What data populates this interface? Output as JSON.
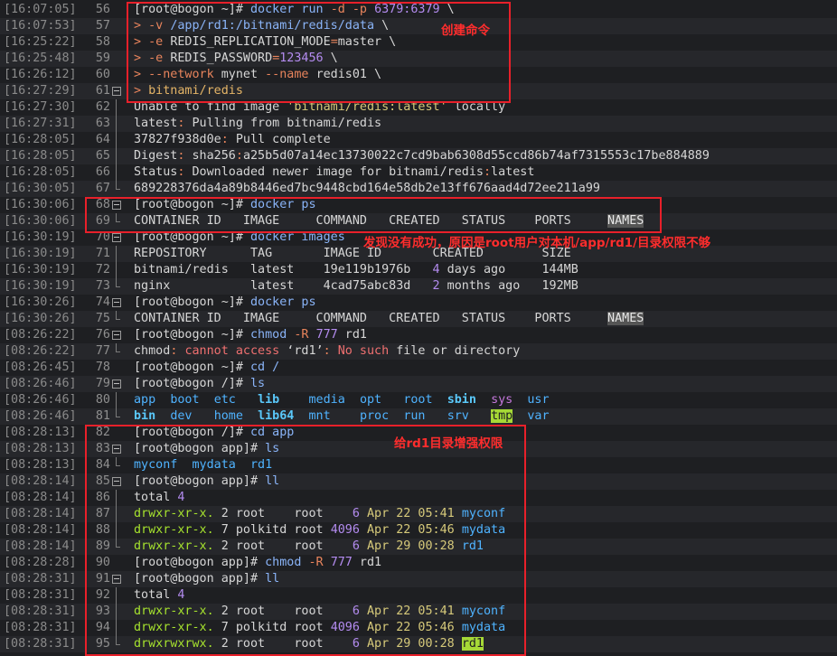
{
  "terminal": {
    "lines": [
      {
        "ts": "[16:07:05]",
        "ln": "56",
        "fold": "none",
        "segs": [
          [
            "[root@bogon ~]# ",
            "t-prompt"
          ],
          [
            "docker run ",
            "t-cmd"
          ],
          [
            "-d -p ",
            "t-opt"
          ],
          [
            "6379:6379",
            "t-num"
          ],
          [
            " \\",
            "t-def"
          ]
        ]
      },
      {
        "ts": "[16:07:53]",
        "ln": "57",
        "fold": "none",
        "segs": [
          [
            "> ",
            "t-opt"
          ],
          [
            "-v ",
            "t-opt"
          ],
          [
            "/app/rd1:/bitnami/redis/data",
            "t-cmd"
          ],
          [
            " \\",
            "t-def"
          ]
        ]
      },
      {
        "ts": "[16:25:22]",
        "ln": "58",
        "fold": "none",
        "segs": [
          [
            "> ",
            "t-opt"
          ],
          [
            "-e ",
            "t-opt"
          ],
          [
            "REDIS_REPLICATION_MODE",
            "t-def"
          ],
          [
            "=",
            "t-opt"
          ],
          [
            "master",
            "t-def"
          ],
          [
            " \\",
            "t-def"
          ]
        ]
      },
      {
        "ts": "[16:25:48]",
        "ln": "59",
        "fold": "none",
        "segs": [
          [
            "> ",
            "t-opt"
          ],
          [
            "-e ",
            "t-opt"
          ],
          [
            "REDIS_PASSWORD",
            "t-def"
          ],
          [
            "=",
            "t-opt"
          ],
          [
            "123456",
            "t-num"
          ],
          [
            " \\",
            "t-def"
          ]
        ]
      },
      {
        "ts": "[16:26:12]",
        "ln": "60",
        "fold": "none",
        "segs": [
          [
            "> ",
            "t-opt"
          ],
          [
            "--network ",
            "t-opt"
          ],
          [
            "mynet ",
            "t-def"
          ],
          [
            "--name ",
            "t-opt"
          ],
          [
            "redis01",
            "t-def"
          ],
          [
            " \\",
            "t-def"
          ]
        ]
      },
      {
        "ts": "[16:27:29]",
        "ln": "61",
        "fold": "start",
        "segs": [
          [
            "> ",
            "t-opt"
          ],
          [
            "bitnami/redis",
            "t-gold"
          ]
        ]
      },
      {
        "ts": "[16:27:30]",
        "ln": "62",
        "fold": "mid",
        "segs": [
          [
            "Unable to find image ",
            "t-def"
          ],
          [
            "'bitnami/redis:latest'",
            "t-str"
          ],
          [
            " locally",
            "t-def"
          ]
        ]
      },
      {
        "ts": "[16:27:31]",
        "ln": "63",
        "fold": "mid",
        "segs": [
          [
            "latest",
            "t-def"
          ],
          [
            ": ",
            "t-opt"
          ],
          [
            "Pulling from bitnami/redis",
            "t-def"
          ]
        ]
      },
      {
        "ts": "[16:28:05]",
        "ln": "64",
        "fold": "mid",
        "segs": [
          [
            "37827f938d0e",
            "t-def"
          ],
          [
            ": ",
            "t-opt"
          ],
          [
            "Pull complete",
            "t-def"
          ]
        ]
      },
      {
        "ts": "[16:28:05]",
        "ln": "65",
        "fold": "mid",
        "segs": [
          [
            "Digest",
            "t-def"
          ],
          [
            ": ",
            "t-opt"
          ],
          [
            "sha256",
            "t-def"
          ],
          [
            ":",
            "t-opt"
          ],
          [
            "a25b5d07a14ec13730022c7cd9bab6308d55ccd86b74af7315553c17be884889",
            "t-def"
          ]
        ]
      },
      {
        "ts": "[16:28:05]",
        "ln": "66",
        "fold": "mid",
        "segs": [
          [
            "Status",
            "t-def"
          ],
          [
            ": ",
            "t-opt"
          ],
          [
            "Downloaded newer image for bitnami/redis",
            "t-def"
          ],
          [
            ":",
            "t-opt"
          ],
          [
            "latest",
            "t-def"
          ]
        ]
      },
      {
        "ts": "[16:30:05]",
        "ln": "67",
        "fold": "end",
        "segs": [
          [
            "689228376da4a89b8446ed7bc9448cbd164e58db2e13ff676aad4d72ee211a99",
            "t-def"
          ]
        ]
      },
      {
        "ts": "[16:30:06]",
        "ln": "68",
        "fold": "start",
        "segs": [
          [
            "[root@bogon ~]# ",
            "t-prompt"
          ],
          [
            "docker ps",
            "t-cmd"
          ]
        ]
      },
      {
        "ts": "[16:30:06]",
        "ln": "69",
        "fold": "end",
        "segs": [
          [
            "CONTAINER ID   IMAGE     COMMAND   CREATED   STATUS    PORTS     ",
            "t-def"
          ],
          [
            "NAMES",
            "t-hiname"
          ]
        ]
      },
      {
        "ts": "[16:30:19]",
        "ln": "70",
        "fold": "start",
        "segs": [
          [
            "[root@bogon ~]# ",
            "t-prompt"
          ],
          [
            "docker images",
            "t-cmd"
          ]
        ]
      },
      {
        "ts": "[16:30:19]",
        "ln": "71",
        "fold": "mid",
        "segs": [
          [
            "REPOSITORY      TAG       IMAGE ID       CREATED        SIZE",
            "t-def"
          ]
        ]
      },
      {
        "ts": "[16:30:19]",
        "ln": "72",
        "fold": "mid",
        "segs": [
          [
            "bitnami/redis   latest    19e119b1976b   ",
            "t-def"
          ],
          [
            "4",
            "t-num"
          ],
          [
            " days ago     144MB",
            "t-def"
          ]
        ]
      },
      {
        "ts": "[16:30:19]",
        "ln": "73",
        "fold": "end",
        "segs": [
          [
            "nginx           latest    4cad75abc83d   ",
            "t-def"
          ],
          [
            "2",
            "t-num"
          ],
          [
            " months ago   192MB",
            "t-def"
          ]
        ]
      },
      {
        "ts": "[16:30:26]",
        "ln": "74",
        "fold": "start",
        "segs": [
          [
            "[root@bogon ~]# ",
            "t-prompt"
          ],
          [
            "docker ps",
            "t-cmd"
          ]
        ]
      },
      {
        "ts": "[16:30:26]",
        "ln": "75",
        "fold": "end",
        "segs": [
          [
            "CONTAINER ID   IMAGE     COMMAND   CREATED   STATUS    PORTS     ",
            "t-def"
          ],
          [
            "NAMES",
            "t-hiname"
          ]
        ]
      },
      {
        "ts": "[08:26:22]",
        "ln": "76",
        "fold": "start",
        "segs": [
          [
            "[root@bogon ~]# ",
            "t-prompt"
          ],
          [
            "chmod ",
            "t-cmd"
          ],
          [
            "-R ",
            "t-opt"
          ],
          [
            "777",
            "t-num"
          ],
          [
            " rd1",
            "t-def"
          ]
        ]
      },
      {
        "ts": "[08:26:22]",
        "ln": "77",
        "fold": "end",
        "segs": [
          [
            "chmod",
            "t-def"
          ],
          [
            ": ",
            "t-opt"
          ],
          [
            "cannot access",
            "t-key"
          ],
          [
            " ‘rd1’",
            "t-def"
          ],
          [
            ": ",
            "t-opt"
          ],
          [
            "No such",
            "t-key"
          ],
          [
            " file or directory",
            "t-def"
          ]
        ]
      },
      {
        "ts": "[08:26:45]",
        "ln": "78",
        "fold": "none",
        "segs": [
          [
            "[root@bogon ~]# ",
            "t-prompt"
          ],
          [
            "cd /",
            "t-cmd"
          ]
        ]
      },
      {
        "ts": "[08:26:46]",
        "ln": "79",
        "fold": "start",
        "segs": [
          [
            "[root@bogon /]# ",
            "t-prompt"
          ],
          [
            "ls",
            "t-cmd"
          ]
        ]
      },
      {
        "ts": "[08:26:46]",
        "ln": "80",
        "fold": "mid",
        "segs": [
          [
            "app",
            "t-dir"
          ],
          [
            "  ",
            "t-def"
          ],
          [
            "boot",
            "t-dir"
          ],
          [
            "  ",
            "t-def"
          ],
          [
            "etc",
            "t-dir"
          ],
          [
            "   ",
            "t-def"
          ],
          [
            "lib",
            "t-bold"
          ],
          [
            "    ",
            "t-def"
          ],
          [
            "media",
            "t-dir"
          ],
          [
            "  ",
            "t-def"
          ],
          [
            "opt",
            "t-dir"
          ],
          [
            "   ",
            "t-def"
          ],
          [
            "root",
            "t-dir"
          ],
          [
            "  ",
            "t-def"
          ],
          [
            "sbin",
            "t-bold"
          ],
          [
            "  ",
            "t-def"
          ],
          [
            "sys",
            "t-purple"
          ],
          [
            "  ",
            "t-def"
          ],
          [
            "usr",
            "t-dir"
          ]
        ]
      },
      {
        "ts": "[08:26:46]",
        "ln": "81",
        "fold": "end",
        "segs": [
          [
            "bin",
            "t-bold"
          ],
          [
            "  ",
            "t-def"
          ],
          [
            "dev",
            "t-dir"
          ],
          [
            "   ",
            "t-def"
          ],
          [
            "home",
            "t-dir"
          ],
          [
            "  ",
            "t-def"
          ],
          [
            "lib64",
            "t-bold"
          ],
          [
            "  ",
            "t-def"
          ],
          [
            "mnt",
            "t-dir"
          ],
          [
            "    ",
            "t-def"
          ],
          [
            "proc",
            "t-dir"
          ],
          [
            "  ",
            "t-def"
          ],
          [
            "run",
            "t-dir"
          ],
          [
            "   ",
            "t-def"
          ],
          [
            "srv",
            "t-dir"
          ],
          [
            "   ",
            "t-def"
          ],
          [
            "tmp",
            "t-hi"
          ],
          [
            "  ",
            "t-def"
          ],
          [
            "var",
            "t-dir"
          ]
        ]
      },
      {
        "ts": "[08:28:13]",
        "ln": "82",
        "fold": "none",
        "segs": [
          [
            "[root@bogon /]# ",
            "t-prompt"
          ],
          [
            "cd app",
            "t-cmd"
          ]
        ]
      },
      {
        "ts": "[08:28:13]",
        "ln": "83",
        "fold": "start",
        "segs": [
          [
            "[root@bogon app]# ",
            "t-prompt"
          ],
          [
            "ls",
            "t-cmd"
          ]
        ]
      },
      {
        "ts": "[08:28:13]",
        "ln": "84",
        "fold": "end",
        "segs": [
          [
            "myconf",
            "t-dir"
          ],
          [
            "  ",
            "t-def"
          ],
          [
            "mydata",
            "t-dir"
          ],
          [
            "  ",
            "t-def"
          ],
          [
            "rd1",
            "t-dir"
          ]
        ]
      },
      {
        "ts": "[08:28:14]",
        "ln": "85",
        "fold": "start",
        "segs": [
          [
            "[root@bogon app]# ",
            "t-prompt"
          ],
          [
            "ll",
            "t-cmd"
          ]
        ]
      },
      {
        "ts": "[08:28:14]",
        "ln": "86",
        "fold": "mid",
        "segs": [
          [
            "total ",
            "t-def"
          ],
          [
            "4",
            "t-num"
          ]
        ]
      },
      {
        "ts": "[08:28:14]",
        "ln": "87",
        "fold": "mid",
        "segs": [
          [
            "drwxr-xr-x.",
            "t-green"
          ],
          [
            " 2 root    root    ",
            "t-def"
          ],
          [
            "6",
            "t-num"
          ],
          [
            " ",
            "t-def"
          ],
          [
            "Apr 22 05:41",
            "t-date"
          ],
          [
            " ",
            "t-def"
          ],
          [
            "myconf",
            "t-dir"
          ]
        ]
      },
      {
        "ts": "[08:28:14]",
        "ln": "88",
        "fold": "mid",
        "segs": [
          [
            "drwxr-xr-x.",
            "t-green"
          ],
          [
            " 7 polkitd root ",
            "t-def"
          ],
          [
            "4096",
            "t-num"
          ],
          [
            " ",
            "t-def"
          ],
          [
            "Apr 22 05:46",
            "t-date"
          ],
          [
            " ",
            "t-def"
          ],
          [
            "mydata",
            "t-dir"
          ]
        ]
      },
      {
        "ts": "[08:28:14]",
        "ln": "89",
        "fold": "end",
        "segs": [
          [
            "drwxr-xr-x.",
            "t-green"
          ],
          [
            " 2 root    root    ",
            "t-def"
          ],
          [
            "6",
            "t-num"
          ],
          [
            " ",
            "t-def"
          ],
          [
            "Apr 29 00:28",
            "t-date"
          ],
          [
            " ",
            "t-def"
          ],
          [
            "rd1",
            "t-dir"
          ]
        ]
      },
      {
        "ts": "[08:28:28]",
        "ln": "90",
        "fold": "none",
        "segs": [
          [
            "[root@bogon app]# ",
            "t-prompt"
          ],
          [
            "chmod ",
            "t-cmd"
          ],
          [
            "-R ",
            "t-opt"
          ],
          [
            "777",
            "t-num"
          ],
          [
            " rd1",
            "t-def"
          ]
        ]
      },
      {
        "ts": "[08:28:31]",
        "ln": "91",
        "fold": "start",
        "segs": [
          [
            "[root@bogon app]# ",
            "t-prompt"
          ],
          [
            "ll",
            "t-cmd"
          ]
        ]
      },
      {
        "ts": "[08:28:31]",
        "ln": "92",
        "fold": "mid",
        "segs": [
          [
            "total ",
            "t-def"
          ],
          [
            "4",
            "t-num"
          ]
        ]
      },
      {
        "ts": "[08:28:31]",
        "ln": "93",
        "fold": "mid",
        "segs": [
          [
            "drwxr-xr-x.",
            "t-green"
          ],
          [
            " 2 root    root    ",
            "t-def"
          ],
          [
            "6",
            "t-num"
          ],
          [
            " ",
            "t-def"
          ],
          [
            "Apr 22 05:41",
            "t-date"
          ],
          [
            " ",
            "t-def"
          ],
          [
            "myconf",
            "t-dir"
          ]
        ]
      },
      {
        "ts": "[08:28:31]",
        "ln": "94",
        "fold": "mid",
        "segs": [
          [
            "drwxr-xr-x.",
            "t-green"
          ],
          [
            " 7 polkitd root ",
            "t-def"
          ],
          [
            "4096",
            "t-num"
          ],
          [
            " ",
            "t-def"
          ],
          [
            "Apr 22 05:46",
            "t-date"
          ],
          [
            " ",
            "t-def"
          ],
          [
            "mydata",
            "t-dir"
          ]
        ]
      },
      {
        "ts": "[08:28:31]",
        "ln": "95",
        "fold": "end",
        "segs": [
          [
            "drwxrwxrwx.",
            "t-green"
          ],
          [
            " 2 root    root    ",
            "t-def"
          ],
          [
            "6",
            "t-num"
          ],
          [
            " ",
            "t-def"
          ],
          [
            "Apr 29 00:28",
            "t-date"
          ],
          [
            " ",
            "t-def"
          ],
          [
            "rd1",
            "t-hi"
          ]
        ]
      }
    ]
  },
  "annotations": {
    "create_command": "创建命令",
    "not_success": "发现没有成功，原因是root用户对本机/app/rd1/目录权限不够",
    "grant_permission": "给rd1目录增强权限"
  },
  "colors": {
    "background": "#1e1f22",
    "annotation_red": "#e8202a"
  }
}
